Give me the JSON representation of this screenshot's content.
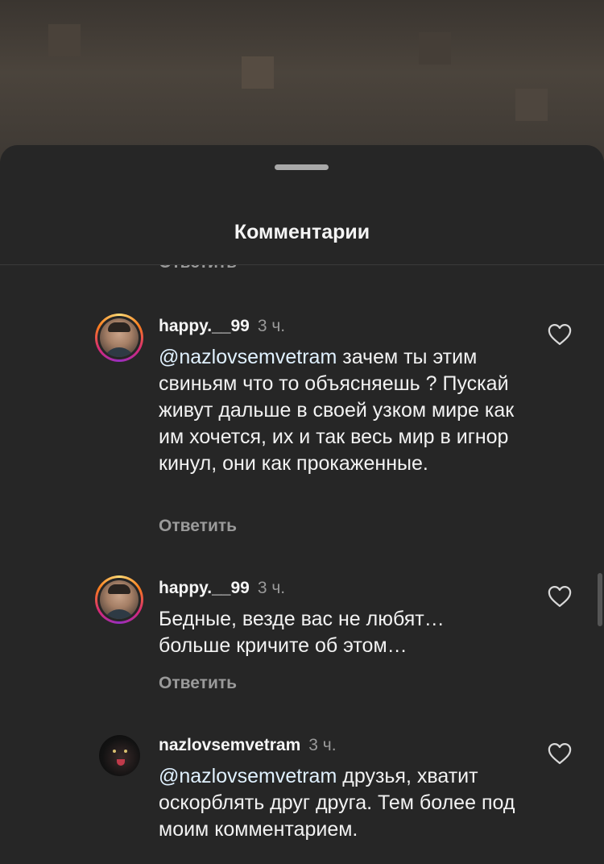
{
  "sheet": {
    "title": "Комментарии"
  },
  "partial_reply_label": "Ответить",
  "comments": [
    {
      "username": "happy.__99",
      "time": "3 ч.",
      "mention": "@nazlovsemvetram",
      "text": " зачем ты этим свиньям что то объясняешь ? Пускай живут дальше в своей узком мире как им хочется, их и так весь мир в игнор кинул, они как прокаженные.",
      "reply_label": "Ответить",
      "avatar": "person-photo"
    },
    {
      "username": "happy.__99",
      "time": "3 ч.",
      "mention": "",
      "text": "Бедные, везде вас не любят… больше кричите об этом…",
      "reply_label": "Ответить",
      "avatar": "person-photo"
    },
    {
      "username": "nazlovsemvetram",
      "time": "3 ч.",
      "mention": "@nazlovsemvetram",
      "text": " друзья, хватит оскорблять друг друга. Тем более под моим комментарием.",
      "reply_label": "",
      "avatar": "dark-animal-photo"
    }
  ],
  "icons": {
    "like": "heart-outline-icon",
    "handle": "drag-handle"
  },
  "colors": {
    "background": "#262626",
    "text": "#f2f2f2",
    "muted": "#9a9a9a",
    "mention": "#e0f1ff"
  }
}
